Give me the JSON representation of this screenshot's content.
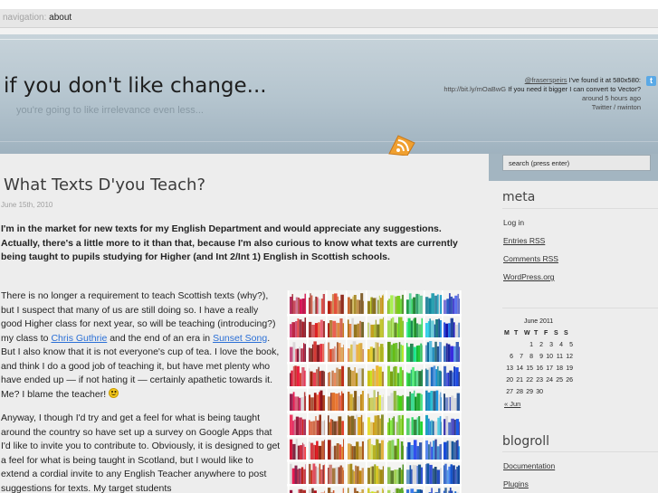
{
  "nav": {
    "label": "navigation:",
    "items": [
      {
        "label": "about"
      }
    ]
  },
  "header": {
    "site_title": "if you don't like change...",
    "tagline": "you're going to like irrelevance even less...",
    "tweet": {
      "user": "@fraserspeirs",
      "text_1": " I've found it at 580x580:",
      "link": "http://bit.ly/mOaBwG",
      "text_2": " If you need it bigger I can convert to Vector?",
      "time": "around 5 hours ago",
      "source": "Twitter / nwinton"
    },
    "icons": {
      "twitter": "twitter-icon",
      "rss": "rss-feed-icon"
    }
  },
  "post": {
    "title": "What Texts D'you Teach?",
    "date": "June 15th, 2010",
    "intro": "I'm in the market for new texts for my English Department and would appreciate any suggestions. Actually, there's a little more to it than that, because I'm also curious to know what texts are currently being taught to pupils studying for Higher (and Int 2/Int 1) English in Scottish schools.",
    "p1": {
      "a": "There is no longer a requirement to teach Scottish texts (why?), but I suspect that many of us are still doing so. I have a really good Higher class for next year, so will be teaching (introducing?) my class to ",
      "link1": "Chris Guthrie",
      "b": " and the end of an era in ",
      "link2": "Sunset Song",
      "c": ". But I also know that it is not everyone's cup of tea. I love the book, and think I do a good job of teaching it, but have met plenty who have ended up — if not hating it — certainly apathetic towards it. Me? I blame the teacher! "
    },
    "p2": "Anyway, I though I'd try and get a feel for what is being taught around the country so have set up a survey on Google Apps that I'd like to invite you to contribute to. Obviously, it is designed to get a feel for what is being taught in Scotland, but I would like to extend a cordial invite to any English Teacher anywhere to post suggestions for texts. My target students",
    "image": {
      "subject": "bookshelf-photo"
    }
  },
  "sidebar": {
    "search_placeholder": "search (press enter)",
    "meta": {
      "heading": "meta",
      "items": [
        {
          "label": "Log in",
          "underline": false
        },
        {
          "label": "Entries RSS",
          "underline": true
        },
        {
          "label": "Comments RSS",
          "underline": true
        },
        {
          "label": "WordPress.org",
          "underline": true
        }
      ]
    },
    "calendar": {
      "caption": "June 2011",
      "days": [
        "M",
        "T",
        "W",
        "T",
        "F",
        "S",
        "S"
      ],
      "weeks": [
        [
          "",
          "",
          "1",
          "2",
          "3",
          "4",
          "5"
        ],
        [
          "6",
          "7",
          "8",
          "9",
          "10",
          "11",
          "12"
        ],
        [
          "13",
          "14",
          "15",
          "16",
          "17",
          "18",
          "19"
        ],
        [
          "20",
          "21",
          "22",
          "23",
          "24",
          "25",
          "26"
        ],
        [
          "27",
          "28",
          "29",
          "30",
          "",
          "",
          ""
        ]
      ],
      "prev_link": "« Jun"
    },
    "blogroll": {
      "heading": "blogroll",
      "items": [
        {
          "label": "Documentation"
        },
        {
          "label": "Plugins"
        }
      ]
    }
  },
  "colors": {
    "header_top": "#c7d3da",
    "header_bottom": "#9fb2bf",
    "page_background": "#ededed",
    "link_blue": "#2a6fd6",
    "rss_orange": "#f0a030"
  }
}
